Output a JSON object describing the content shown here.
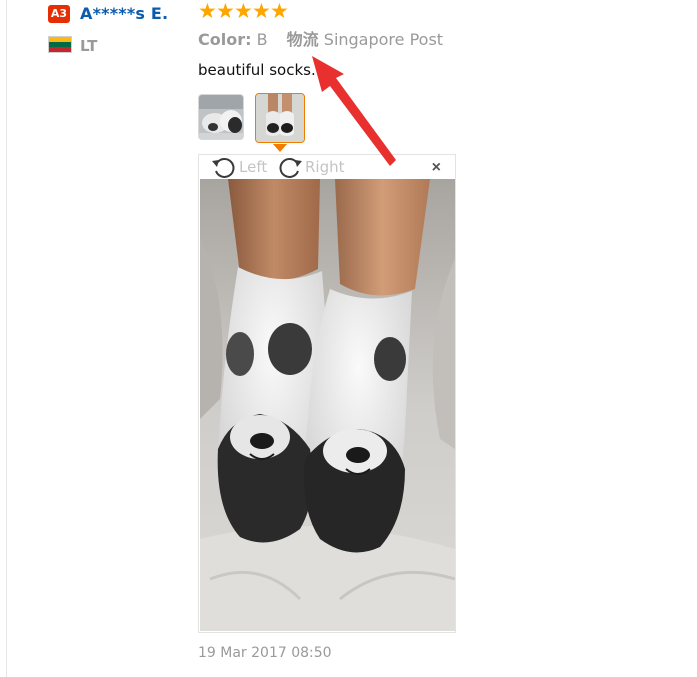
{
  "user": {
    "level_badge": "A3",
    "name": "A*****s E.",
    "country_code": "LT",
    "flag_colors": [
      "#fdb913",
      "#006a44",
      "#c1272d"
    ]
  },
  "review": {
    "rating": 5,
    "star_glyph": "★",
    "star_color": "#ffa500",
    "color_key": "Color:",
    "color_value": "B",
    "shipping_key": "物流",
    "shipping_value": "Singapore Post",
    "text": "beautiful socks.",
    "timestamp": "19 Mar 2017 08:50"
  },
  "photos": {
    "thumbnails": [
      {
        "name": "photo-thumb-1",
        "selected": false
      },
      {
        "name": "photo-thumb-2",
        "selected": true
      }
    ],
    "accent_color": "#f07c00"
  },
  "viewer": {
    "rotate_left_label": "Left",
    "rotate_right_label": "Right",
    "rotate_left_icon": "rotate-left-icon",
    "rotate_right_icon": "rotate-right-icon",
    "close_glyph": "×",
    "close_icon": "close-icon"
  },
  "annotation": {
    "color": "#e8302f",
    "icon": "red-arrow-annotation"
  }
}
